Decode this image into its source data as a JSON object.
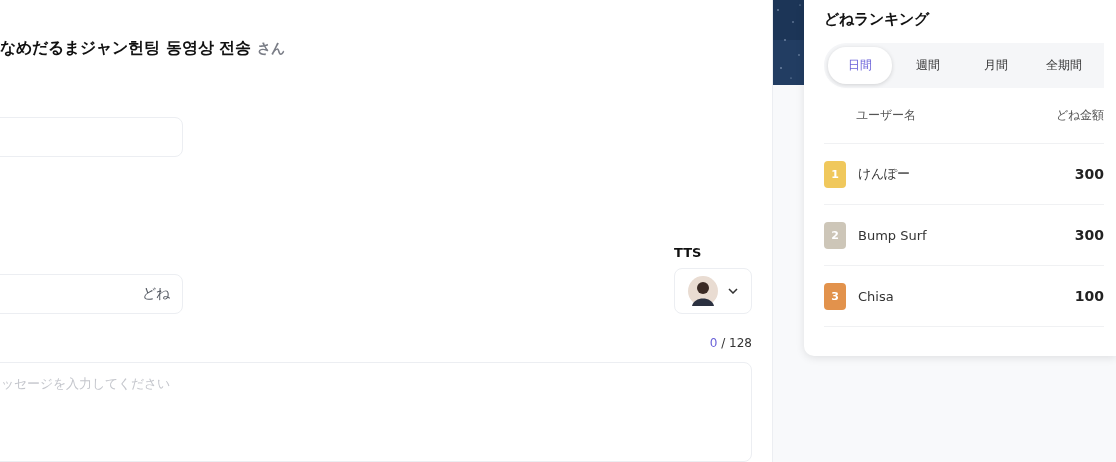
{
  "form": {
    "title": "なめだるまジャン헌팅 동영상 전송",
    "title_suffix": "さん",
    "amount": {
      "suffix": "どね"
    },
    "tts": {
      "label": "TTS"
    },
    "counter": {
      "current": "0",
      "max": "/ 128"
    },
    "message": {
      "placeholder": "ッセージを入力してください"
    }
  },
  "ranking": {
    "title": "どねランキング",
    "tabs": [
      {
        "label": "日間",
        "selected": true
      },
      {
        "label": "週間",
        "selected": false
      },
      {
        "label": "月間",
        "selected": false
      },
      {
        "label": "全期間",
        "selected": false
      }
    ],
    "columns": [
      "ユーザー名",
      "どね金額"
    ],
    "rows": [
      {
        "rank": "1",
        "color": "#f0c85c",
        "name": "けんぽー",
        "amount": "300"
      },
      {
        "rank": "2",
        "color": "#cdc6b8",
        "name": "Bump Surf",
        "amount": "300"
      },
      {
        "rank": "3",
        "color": "#e2924c",
        "name": "Chisa",
        "amount": "100"
      }
    ]
  }
}
